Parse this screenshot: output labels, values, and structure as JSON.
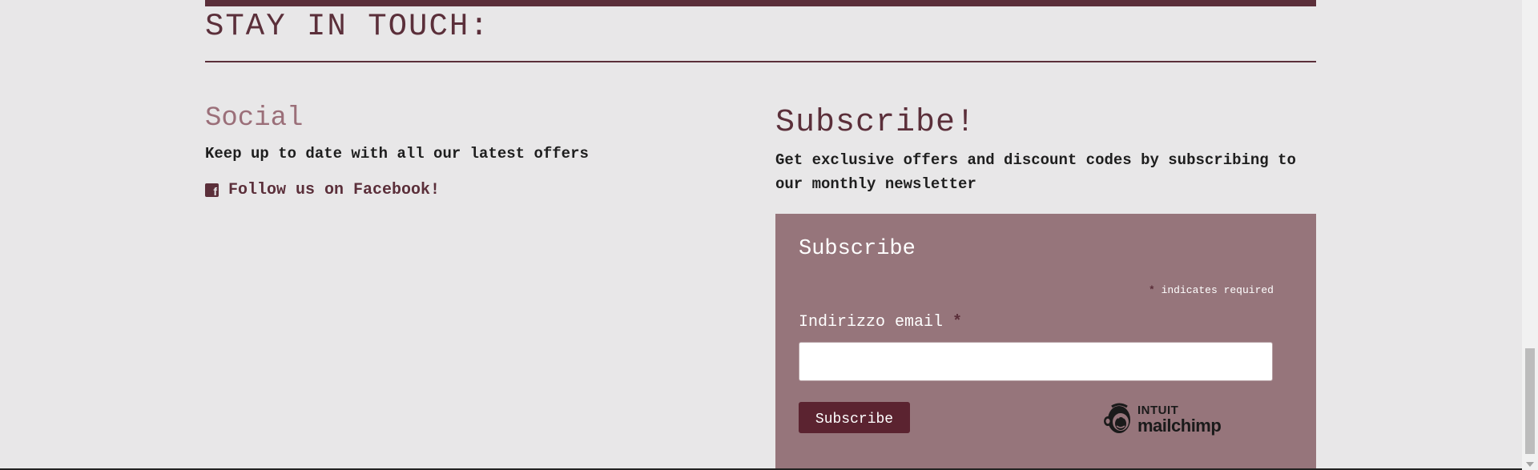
{
  "section": {
    "title": "STAY IN TOUCH:"
  },
  "social": {
    "heading": "Social",
    "description": "Keep up to date with all our latest offers",
    "facebook_link": "Follow us on Facebook!",
    "facebook_icon": "facebook-square-icon"
  },
  "newsletter": {
    "heading": "Subscribe!",
    "description": "Get exclusive offers and discount codes by subscribing to our monthly newsletter"
  },
  "form": {
    "title": "Subscribe",
    "required_asterisk": "*",
    "required_note": "indicates required",
    "email_label": "Indirizzo email",
    "email_value": "",
    "submit_label": "Subscribe",
    "brand_line1": "INTUIT",
    "brand_line2": "mailchimp"
  },
  "colors": {
    "accent": "#5b2f3a",
    "form_background": "#96757b",
    "page_background": "#e8e7e8",
    "button_background": "#5b2330"
  }
}
